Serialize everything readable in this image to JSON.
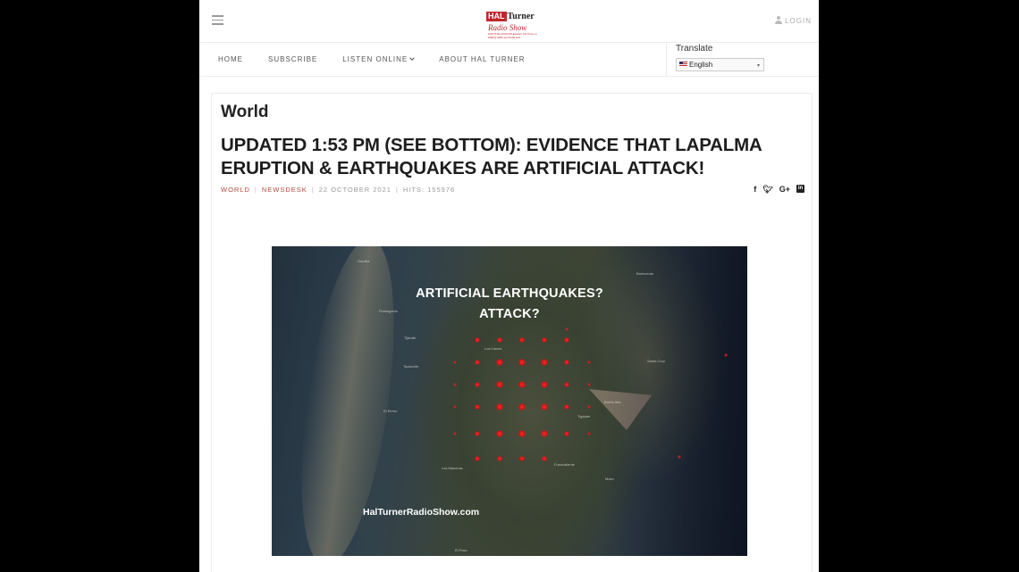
{
  "header": {
    "logo": {
      "hal": "HAL",
      "turner": "Turner",
      "radio": "Radio Show",
      "fine": "WLP 8:00-10:00 PM Eastern US Time on WBCQ 9330 and 5130 kHz"
    },
    "login_label": "LOGIN"
  },
  "nav": {
    "items": [
      {
        "label": "HOME"
      },
      {
        "label": "SUBSCRIBE"
      },
      {
        "label": "LISTEN ONLINE"
      },
      {
        "label": "ABOUT HAL TURNER"
      }
    ]
  },
  "translate": {
    "label": "Translate",
    "selected_language": "English"
  },
  "article": {
    "category_title": "World",
    "headline": "UPDATED 1:53 PM (SEE BOTTOM): EVIDENCE THAT LAPALMA ERUPTION & EARTHQUAKES ARE ARTIFICIAL ATTACK!",
    "meta": {
      "category": "WORLD",
      "author": "NEWSDESK",
      "date": "22 OCTOBER 2021",
      "hits": "HITS: 155976"
    },
    "social": [
      "facebook-icon",
      "twitter-icon",
      "google-plus-icon",
      "linkedin-icon"
    ],
    "image": {
      "title_line1": "ARTIFICIAL EARTHQUAKES?",
      "title_line2": "ATTACK?",
      "watermark": "HalTurnerRadioShow.com",
      "places": [
        "Tijarafe",
        "Puntagorda",
        "Los Llanos",
        "El Paso",
        "Tazacorte",
        "Santa Cruz",
        "Breña Alta",
        "Fuencaliente",
        "Mazo",
        "El Remo",
        "Las Manchas",
        "Tigalate",
        "Garafía",
        "Barlovento"
      ]
    }
  },
  "colors": {
    "brand_red": "#c0272d",
    "meta_red": "#b5473a",
    "dot_red": "#ff2a2a"
  }
}
